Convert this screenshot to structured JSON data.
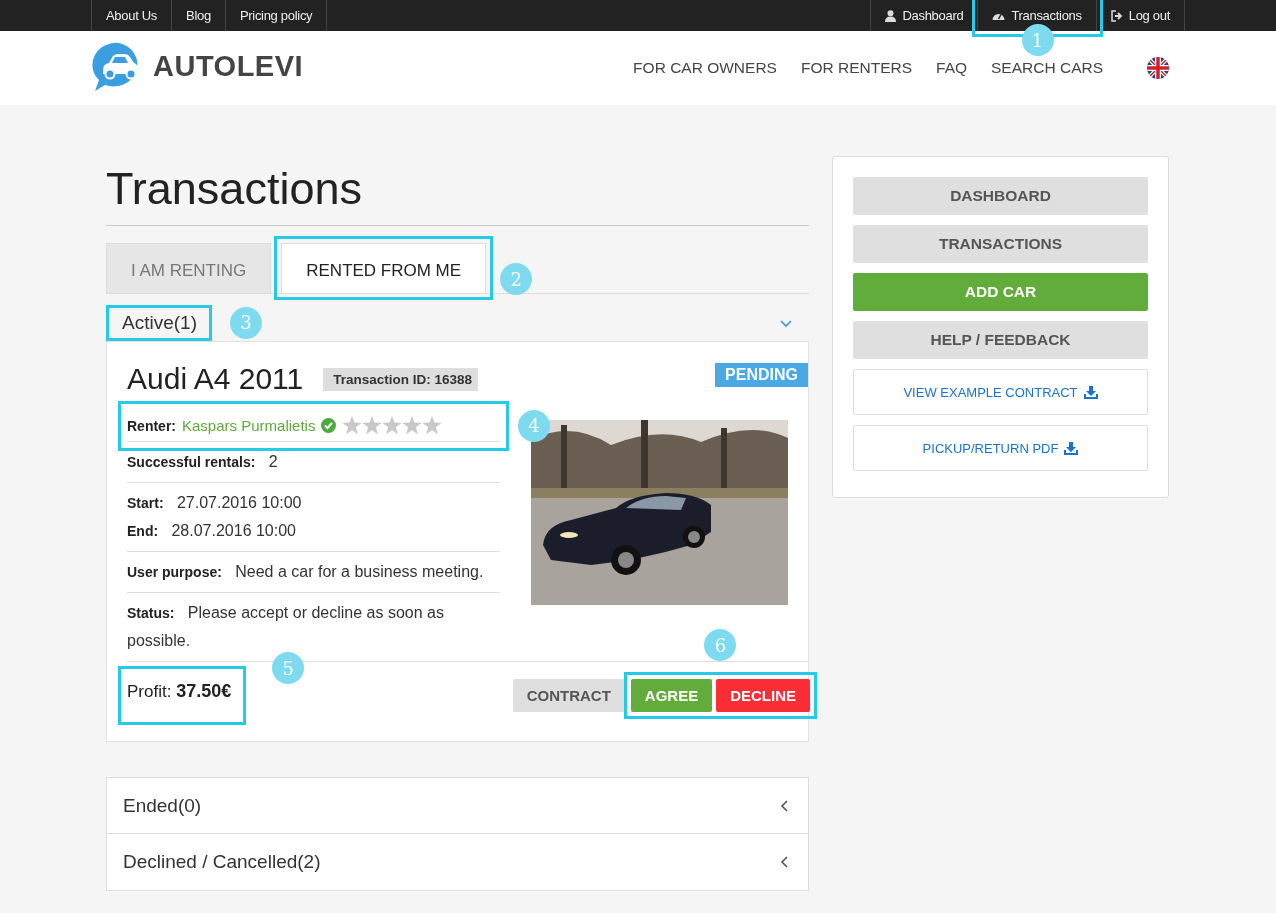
{
  "topbar": {
    "left_links": [
      {
        "label": "About Us"
      },
      {
        "label": "Blog"
      },
      {
        "label": "Pricing policy"
      }
    ],
    "right_links": [
      {
        "label": "Dashboard",
        "kind": "user"
      },
      {
        "label": "Transactions",
        "kind": "gauge",
        "callout": "1"
      },
      {
        "label": "Log out",
        "kind": "logout"
      }
    ]
  },
  "header": {
    "logo": "AUTOLEVI",
    "nav": [
      {
        "label": "FOR CAR OWNERS"
      },
      {
        "label": "FOR RENTERS"
      },
      {
        "label": "FAQ"
      },
      {
        "label": "SEARCH CARS"
      }
    ]
  },
  "page_title": "Transactions",
  "tabs": [
    {
      "label": "I AM RENTING",
      "selected": false
    },
    {
      "label": "RENTED FROM ME",
      "selected": true,
      "callout": "2"
    }
  ],
  "sections": [
    {
      "label": "Active(1)",
      "expanded": true,
      "callout": "3",
      "transaction": {
        "car": "Audi A4 2011",
        "transaction_id": "Transaction ID: 16388",
        "status_badge": "PENDING",
        "rows": [
          {
            "kind": "renter",
            "label": "Renter:",
            "value": "Kaspars Purmalietis",
            "verified": true,
            "stars": 0,
            "callout": "4"
          },
          {
            "kind": "field",
            "label": "Successful rentals:",
            "value": "2"
          },
          {
            "kind": "pair",
            "items": [
              {
                "label": "Start:",
                "value": "27.07.2016 10:00"
              },
              {
                "label": "End:",
                "value": "28.07.2016 10:00"
              }
            ]
          },
          {
            "kind": "field",
            "label": "User purpose:",
            "value": "Need a car for a business meeting."
          },
          {
            "kind": "field",
            "label": "Status:",
            "value": "Please accept or decline as soon as possible."
          }
        ],
        "profit_label": "Profit:",
        "profit": "37.50€",
        "profit_callout": "5",
        "buttons": [
          {
            "label": "CONTRACT",
            "kind": "neutral"
          },
          {
            "label": "AGREE",
            "kind": "success"
          },
          {
            "label": "DECLINE",
            "kind": "danger"
          }
        ],
        "buttons_callout": "6"
      }
    },
    {
      "label": "Ended(0)",
      "expanded": false
    },
    {
      "label": "Declined / Cancelled(2)",
      "expanded": false
    }
  ],
  "sidebar": {
    "buttons": [
      {
        "label": "DASHBOARD",
        "kind": "neutral"
      },
      {
        "label": "TRANSACTIONS",
        "kind": "neutral"
      },
      {
        "label": "ADD CAR",
        "kind": "success"
      },
      {
        "label": "HELP / FEEDBACK",
        "kind": "neutral"
      },
      {
        "label": "VIEW EXAMPLE CONTRACT",
        "kind": "download"
      },
      {
        "label": "PICKUP/RETURN PDF",
        "kind": "download"
      }
    ]
  }
}
